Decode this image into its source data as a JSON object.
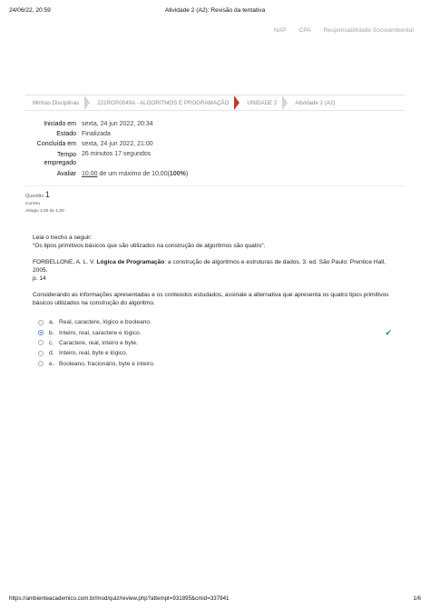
{
  "print_header": {
    "date": "24/06/22, 20:59",
    "title": "Atividade 2 (A2): Revisão da tentativa"
  },
  "topnav": [
    "NAP",
    "CPA",
    "Responsabilidade Socioambiental"
  ],
  "breadcrumb": [
    "Minhas Disciplinas",
    "221RGR0049A - ALGORITMOS E PROGRAMAÇÃO",
    "UNIDADE 2",
    "Atividade 2 (A2)"
  ],
  "summary": {
    "started_label": "Iniciado em",
    "started_value": "sexta, 24 jun 2022, 20:34",
    "state_label": "Estado",
    "state_value": "Finalizada",
    "completed_label": "Concluída em",
    "completed_value": "sexta, 24 jun 2022, 21:00",
    "time_label_1": "Tempo",
    "time_label_2": "empregado",
    "time_value": "26 minutos 17 segundos",
    "grade_label": "Avaliar",
    "grade_score": "10,00",
    "grade_middle": "de um máximo de 10,00(",
    "grade_percent": "100%",
    "grade_end": ")"
  },
  "question": {
    "label": "Questão",
    "number": "1",
    "status": "Correto",
    "score": "Atingiu 1,00 de 1,00",
    "intro": "Leia o trecho a seguir:",
    "quote": "“Os tipos primitivos básicos que são utilizados na construção de algoritmos são quatro”.",
    "ref_author": "FORBELLONE, A. L. V. ",
    "ref_book": "Lógica de Programação",
    "ref_rest_1": ": a construção de algoritmos e estruturas de dados. 3. ed. São Paulo: Prentice Hall, 2005.",
    "ref_rest_2": "p. 14",
    "prompt_1": "Considerando as informações apresentadas e os conteúdos estudados, assinale a alternativa que apresenta os quatro tipos primitivos",
    "prompt_2": "básicos utilizados na construção do algoritmo.",
    "answers": [
      {
        "letter": "a.",
        "text": "Real, caractere, lógico e booleano."
      },
      {
        "letter": "b.",
        "text": "Inteiro, real, caractere e lógico."
      },
      {
        "letter": "c.",
        "text": "Caractere, real, inteiro e byte."
      },
      {
        "letter": "d.",
        "text": "Inteiro, real, byte e lógico."
      },
      {
        "letter": "e.",
        "text": "Booleano, fracionário, byte e inteiro."
      }
    ],
    "check_mark": "✔"
  },
  "print_footer": {
    "url": "https://ambienteacademico.com.br/mod/quiz/review.php?attempt=931895&cmid=337941",
    "page": "1/6"
  }
}
